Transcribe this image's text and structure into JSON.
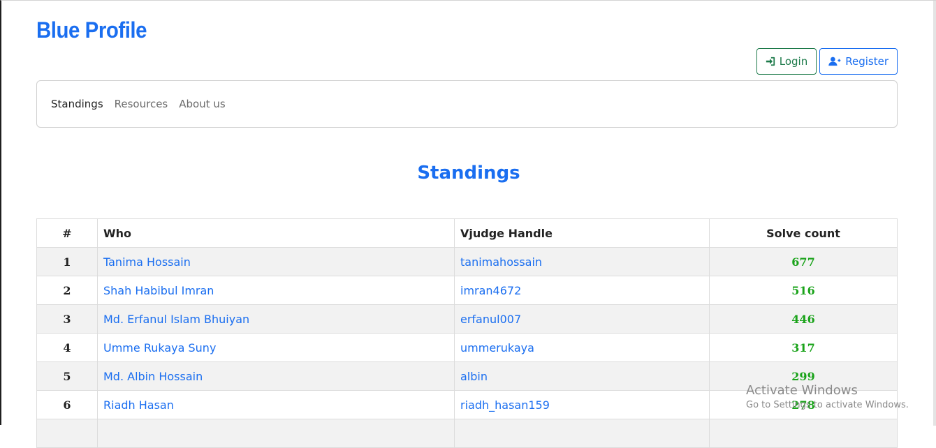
{
  "brand": "Blue Profile",
  "auth": {
    "login": "Login",
    "register": "Register"
  },
  "nav": {
    "items": [
      {
        "label": "Standings",
        "active": true
      },
      {
        "label": "Resources",
        "active": false
      },
      {
        "label": "About us",
        "active": false
      }
    ]
  },
  "page_title": "Standings",
  "table": {
    "headers": {
      "rank": "#",
      "who": "Who",
      "handle": "Vjudge Handle",
      "solve": "Solve count"
    },
    "rows": [
      {
        "rank": "1",
        "who": "Tanima Hossain",
        "handle": "tanimahossain",
        "solve": "677"
      },
      {
        "rank": "2",
        "who": "Shah Habibul Imran",
        "handle": "imran4672",
        "solve": "516"
      },
      {
        "rank": "3",
        "who": "Md. Erfanul Islam Bhuiyan",
        "handle": "erfanul007",
        "solve": "446"
      },
      {
        "rank": "4",
        "who": "Umme Rukaya Suny",
        "handle": "ummerukaya",
        "solve": "317"
      },
      {
        "rank": "5",
        "who": "Md. Albin Hossain",
        "handle": "albin",
        "solve": "299"
      },
      {
        "rank": "6",
        "who": "Riadh Hasan",
        "handle": "riadh_hasan159",
        "solve": "278"
      }
    ]
  },
  "watermark": {
    "title": "Activate Windows",
    "subtitle": "Go to Settings to activate Windows."
  },
  "colors": {
    "brand": "#1a6ef0",
    "login": "#1d7a4a",
    "solve": "#1aa31a"
  },
  "icons": {
    "login": "sign-in-icon",
    "register": "user-plus-icon"
  }
}
